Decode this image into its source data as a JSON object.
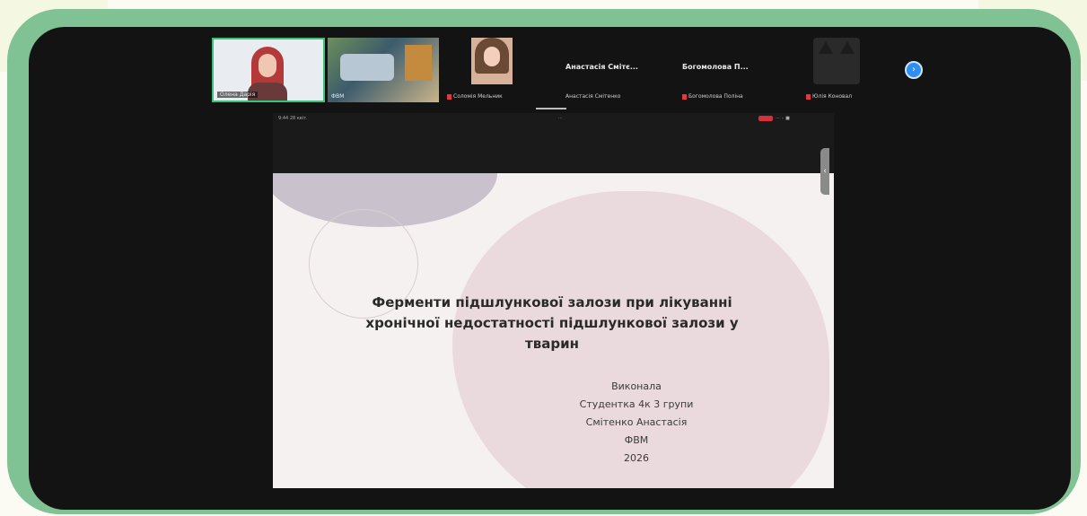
{
  "participants": [
    {
      "name": "Олена Дарія"
    },
    {
      "name": "ФВМ"
    },
    {
      "name": "Соломія Мельник"
    },
    {
      "display_name": "Анастасія Смітє...",
      "sub_name": "Анастасія Смітенко"
    },
    {
      "display_name": "Богомолова П...",
      "sub_name": "Богомолова Поліна"
    },
    {
      "name": "Юлія Коновал"
    }
  ],
  "strip": {
    "next_icon": "›"
  },
  "shared_screen": {
    "top_left": "9:44  28 квіт.",
    "top_center": "···",
    "top_right": "··· ·· ■"
  },
  "slide": {
    "title": "Ферменти  підшлункової залози при лікуванні хронічної  недостатності підшлункової залози у тварин",
    "author_lines": [
      "Виконала",
      "Студентка 4к 3 групи",
      "Смітенко Анастасія",
      "ФВМ",
      "2026"
    ]
  },
  "side_tab_icon": "‹",
  "colors": {
    "frame": "#80c293",
    "screen": "#131313",
    "active_speaker": "#39c27a",
    "mute": "#e0393e",
    "next_button": "#2e8ff0"
  }
}
